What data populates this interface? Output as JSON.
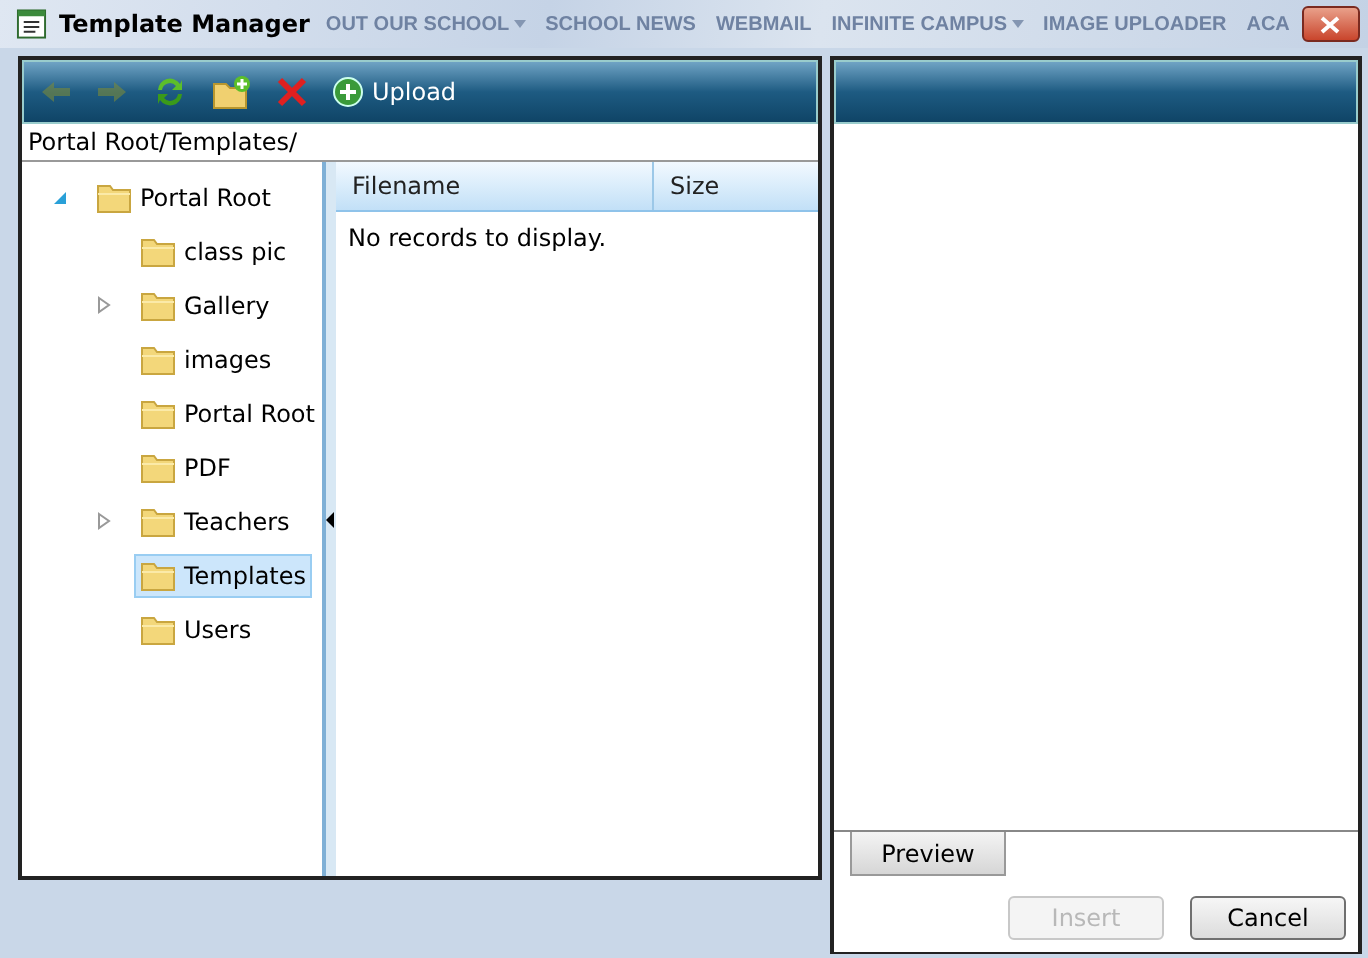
{
  "window": {
    "title": "Template Manager"
  },
  "background_nav": [
    {
      "label": "OUT OUR SCHOOL",
      "dropdown": true
    },
    {
      "label": "SCHOOL NEWS",
      "dropdown": false
    },
    {
      "label": "WEBMAIL",
      "dropdown": false
    },
    {
      "label": "INFINITE CAMPUS",
      "dropdown": true
    },
    {
      "label": "IMAGE UPLOADER",
      "dropdown": false
    },
    {
      "label": "ACA",
      "dropdown": false
    }
  ],
  "toolbar": [
    {
      "kind": "back",
      "disabled": true
    },
    {
      "kind": "forward",
      "disabled": true
    },
    {
      "kind": "refresh",
      "disabled": false
    },
    {
      "kind": "new-folder",
      "disabled": false
    },
    {
      "kind": "delete",
      "disabled": false
    },
    {
      "kind": "upload",
      "label": "Upload",
      "disabled": false
    }
  ],
  "path": "Portal Root/Templates/",
  "tree": [
    {
      "label": "Portal Root",
      "expanded": true,
      "selected": false,
      "children": [
        {
          "label": "class pic",
          "expandable": false,
          "selected": false
        },
        {
          "label": "Gallery",
          "expandable": true,
          "selected": false
        },
        {
          "label": "images",
          "expandable": false,
          "selected": false
        },
        {
          "label": "Portal Root",
          "expandable": false,
          "selected": false
        },
        {
          "label": "PDF",
          "expandable": false,
          "selected": false
        },
        {
          "label": "Teachers",
          "expandable": true,
          "selected": false
        },
        {
          "label": "Templates",
          "expandable": false,
          "selected": true
        },
        {
          "label": "Users",
          "expandable": false,
          "selected": false
        }
      ]
    }
  ],
  "grid": {
    "columns": [
      "Filename",
      "Size"
    ],
    "empty_message": "No records to display."
  },
  "preview_tab": "Preview",
  "buttons": [
    {
      "label": "Insert",
      "disabled": true
    },
    {
      "label": "Cancel",
      "disabled": false
    }
  ]
}
